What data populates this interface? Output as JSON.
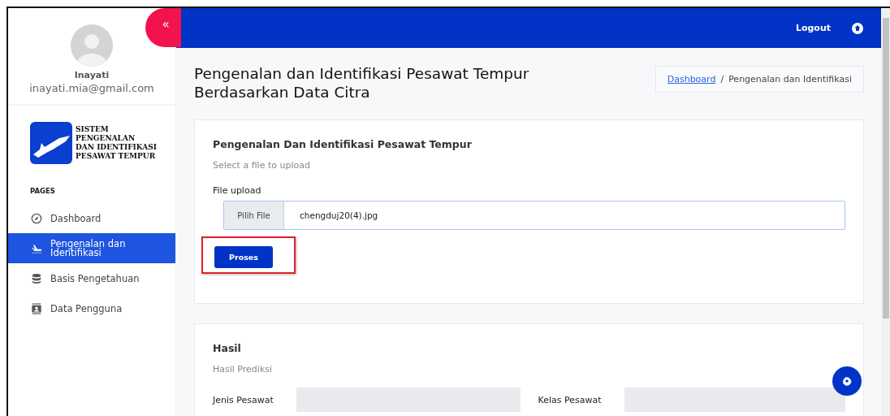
{
  "sidebar": {
    "toggle": "«",
    "user": {
      "name": "Inayati",
      "email": "inayati.mia@gmail.com"
    },
    "logo_lines": [
      "SISTEM",
      "PENGENALAN",
      "DAN IDENTIFIKASI",
      "PESAWAT TEMPUR"
    ],
    "section": "PAGES",
    "items": [
      {
        "label": "Dashboard",
        "selected": false
      },
      {
        "label": "Pengenalan dan Identifikasi",
        "selected": true
      },
      {
        "label": "Basis Pengetahuan",
        "selected": false
      },
      {
        "label": "Data Pengguna",
        "selected": false
      }
    ]
  },
  "topbar": {
    "logout": "Logout"
  },
  "page": {
    "title": "Pengenalan dan Identifikasi Pesawat Tempur Berdasarkan Data Citra",
    "breadcrumb": [
      {
        "label": "Dashboard",
        "link": true
      },
      {
        "label": "Pengenalan dan Identifikasi",
        "link": false
      }
    ],
    "separator": "/"
  },
  "upload_card": {
    "title": "Pengenalan Dan Identifikasi Pesawat Tempur",
    "subtitle": "Select a file to upload",
    "label": "File upload",
    "choose_button": "Pilih File",
    "file_name": "chengduj20(4).jpg",
    "submit": "Proses",
    "submit_highlighted": true
  },
  "result_card": {
    "title": "Hasil",
    "subtitle": "Hasil Prediksi",
    "fields": [
      {
        "label": "Jenis Pesawat"
      },
      {
        "label": "Kelas Pesawat"
      }
    ]
  }
}
